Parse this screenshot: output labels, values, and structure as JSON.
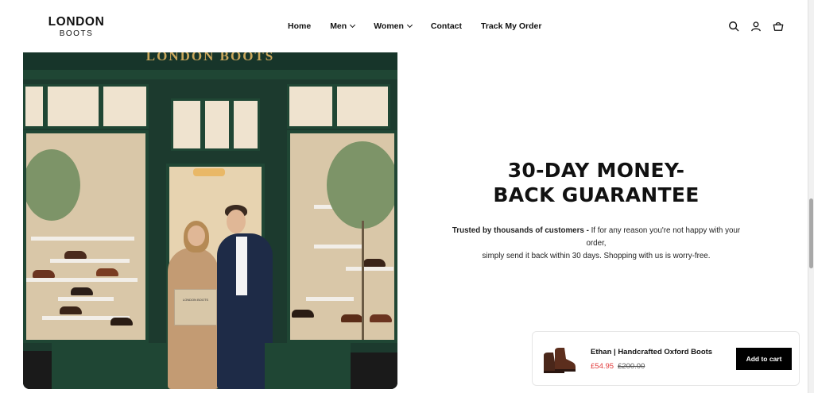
{
  "header": {
    "logo_main": "LONDON",
    "logo_sub": "BOOTS",
    "nav": [
      {
        "label": "Home"
      },
      {
        "label": "Men"
      },
      {
        "label": "Women"
      },
      {
        "label": "Contact"
      },
      {
        "label": "Track My Order"
      }
    ],
    "icons": [
      "search-icon",
      "account-icon",
      "cart-icon"
    ]
  },
  "hero_image": {
    "sign_text": "LONDON BOOTS",
    "bag_text": "LONDON BOOTS"
  },
  "guarantee": {
    "title_line1": "30-DAY MONEY-",
    "title_line2": "BACK GUARANTEE",
    "body_bold": "Trusted by thousands of customers -",
    "body_line1_rest": " If for any reason you're not happy with your order,",
    "body_line2": "simply send it back within 30 days. Shopping with us is worry-free."
  },
  "sticky_cart": {
    "product_title": "Ethan | Handcrafted Oxford Boots",
    "price": "£54.95",
    "compare_price": "£200.00",
    "button_label": "Add to cart"
  },
  "colors": {
    "sale_price": "#e23a3a",
    "store_green": "#1f4634",
    "button": "#000000"
  }
}
